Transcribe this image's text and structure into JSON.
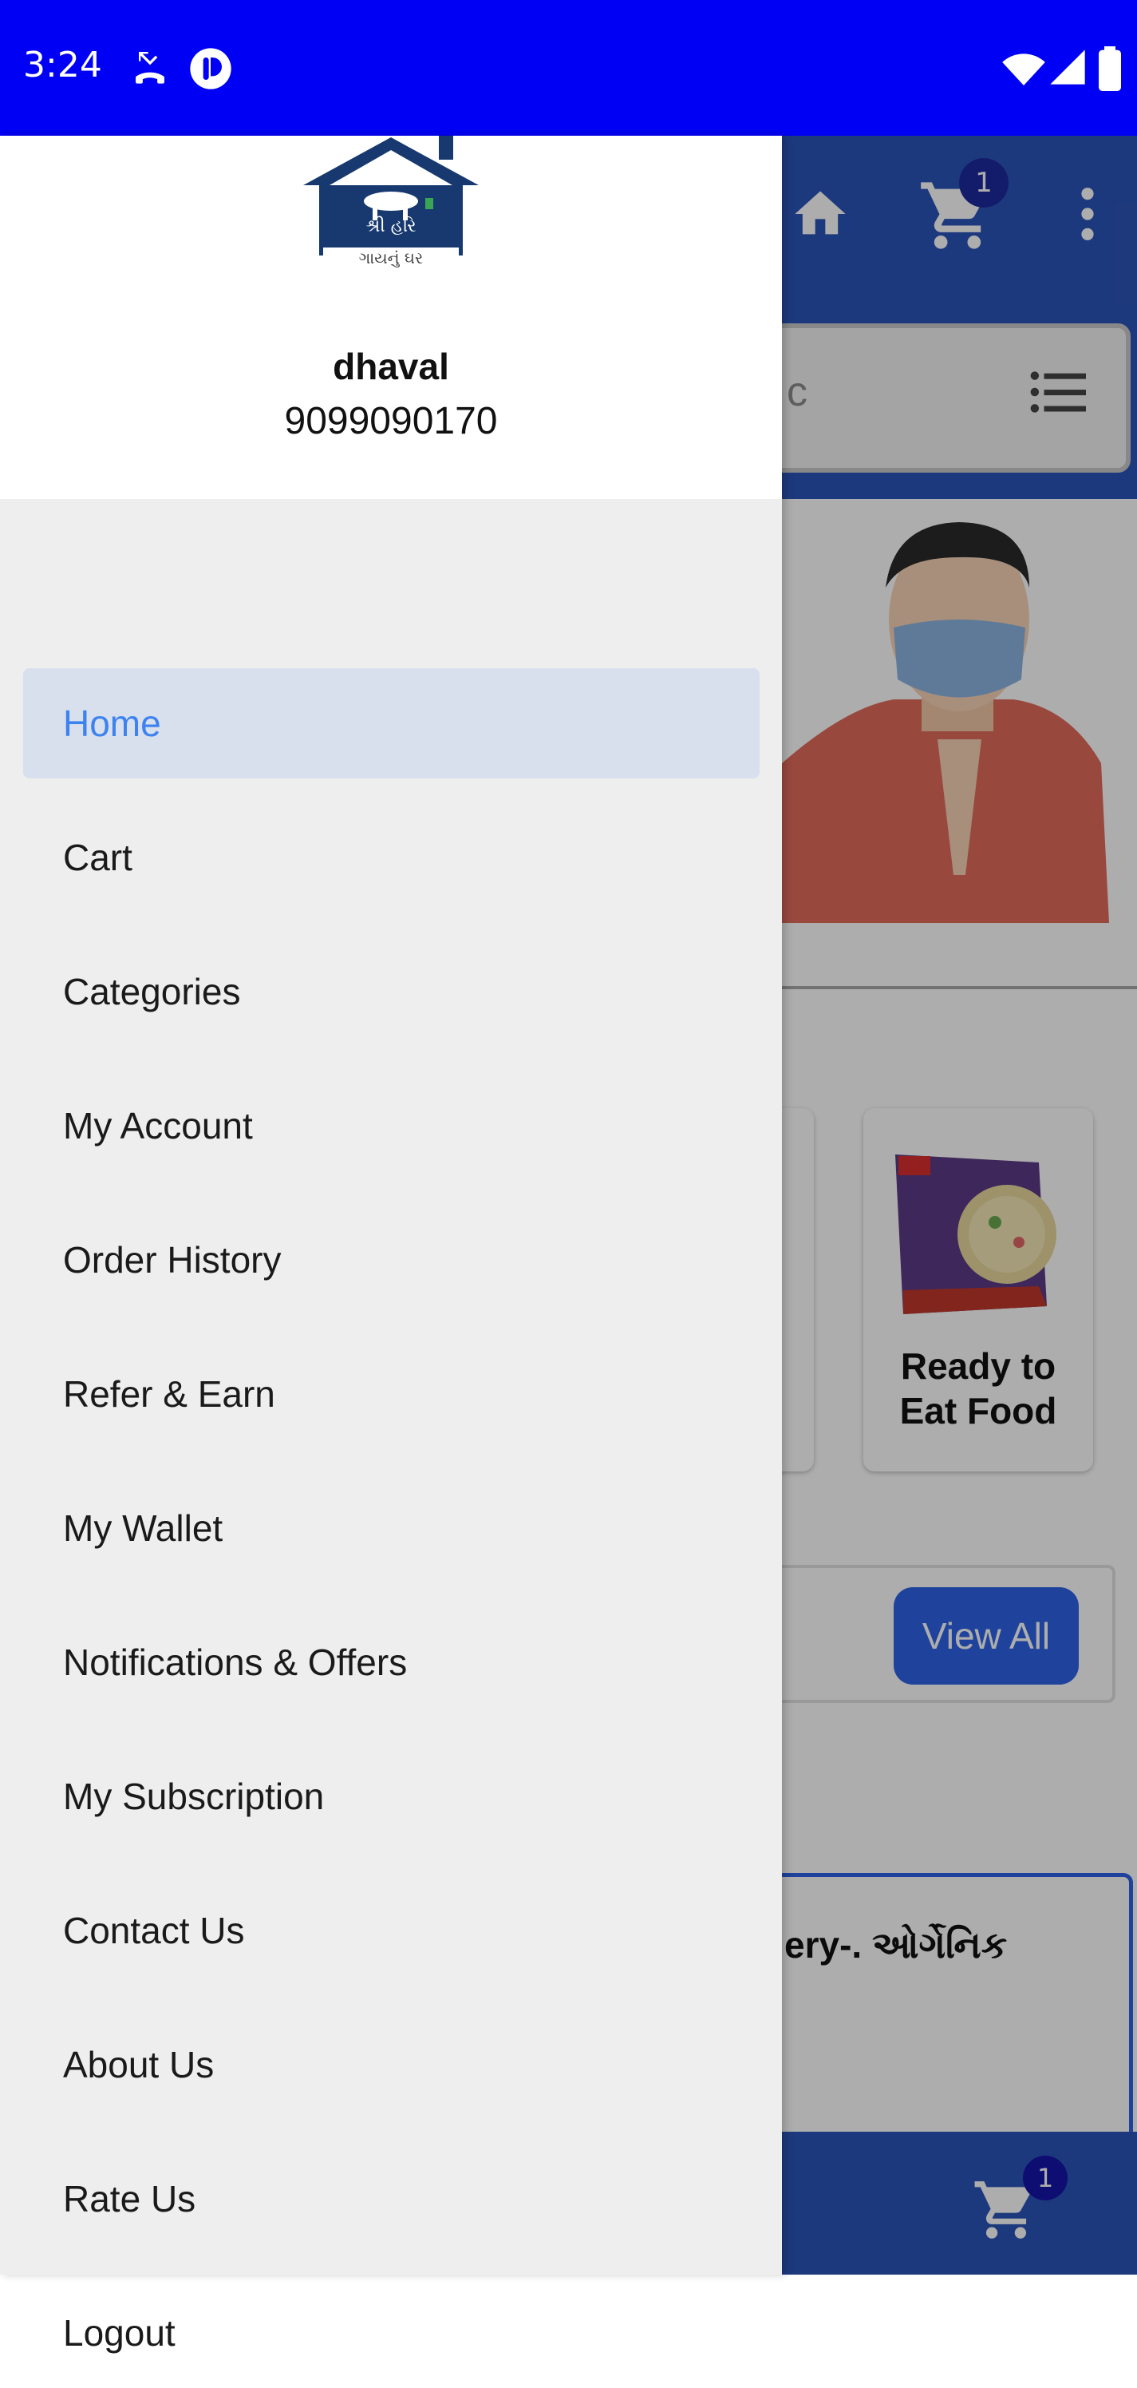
{
  "status_bar": {
    "time": "3:24",
    "left_icons": [
      "missed-call-icon",
      "app-notification-icon"
    ],
    "right_icons": [
      "wifi-icon",
      "signal-icon",
      "battery-icon"
    ],
    "bg_color": "#0000f5"
  },
  "background_app": {
    "header_cart_badge": "1",
    "search_placeholder": "c",
    "category_label": "Ready to Eat Food",
    "view_all_label": "View All",
    "product_title_fragment": "ery-. ઓર્ગેનિક",
    "bottom_cart_badge": "1",
    "accent_color": "#2c55b8"
  },
  "drawer": {
    "logo_text": "શ્રી હરિ ગાયનું ઘર",
    "user": {
      "name": "dhaval",
      "phone": "9099090170"
    },
    "items": [
      {
        "label": "Home",
        "active": true
      },
      {
        "label": "Cart"
      },
      {
        "label": "Categories"
      },
      {
        "label": "My Account"
      },
      {
        "label": "Order History"
      },
      {
        "label": "Refer & Earn"
      },
      {
        "label": "My Wallet"
      },
      {
        "label": "Notifications & Offers"
      },
      {
        "label": "My Subscription"
      },
      {
        "label": "Contact Us"
      },
      {
        "label": "About Us"
      },
      {
        "label": "Rate Us"
      },
      {
        "label": "Logout"
      }
    ],
    "active_color": "#3e82ef",
    "active_bg": "#d8e0ee"
  }
}
